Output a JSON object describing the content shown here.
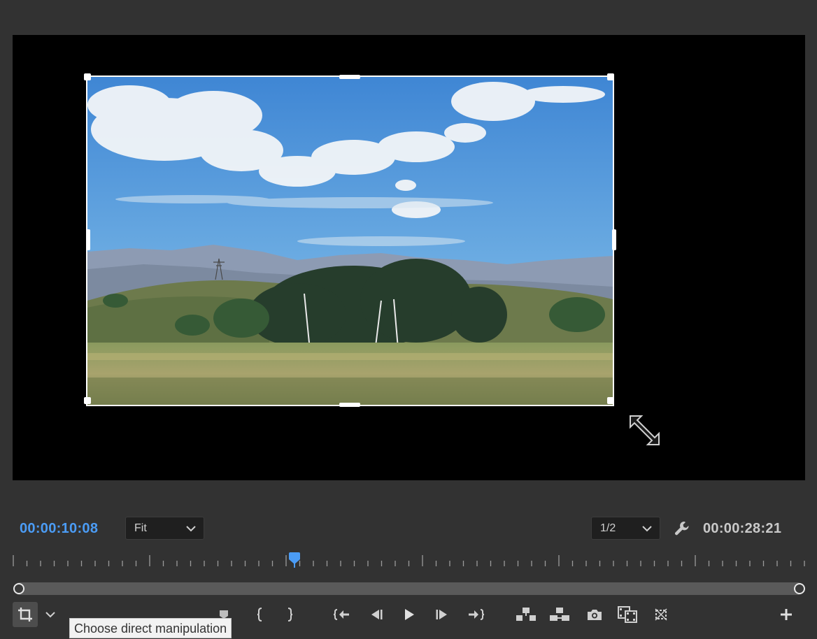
{
  "monitor": {
    "current_timecode": "00:00:10:08",
    "duration_timecode": "00:00:28:21",
    "zoom_level": "Fit",
    "resolution": "1/2",
    "playhead_position_fraction": 0.357
  },
  "tooltip": {
    "text": "Choose direct manipulation"
  },
  "icons": {
    "crop": "crop-icon",
    "chevron": "chevron-down-icon",
    "wrench": "wrench-icon",
    "marker": "marker-icon",
    "mark_in": "mark-in-icon",
    "mark_out": "mark-out-icon",
    "go_to_in": "go-to-in-icon",
    "step_back": "step-back-icon",
    "play": "play-icon",
    "step_forward": "step-forward-icon",
    "go_to_out": "go-to-out-icon",
    "lift": "lift-icon",
    "extract": "extract-icon",
    "export_frame": "camera-icon",
    "comparison_view": "comparison-view-icon",
    "proxy_toggle": "proxy-toggle-icon",
    "add": "plus-icon"
  },
  "colors": {
    "accent": "#4b9cf5",
    "panel_bg": "#323232",
    "viewer_bg": "#000000"
  }
}
